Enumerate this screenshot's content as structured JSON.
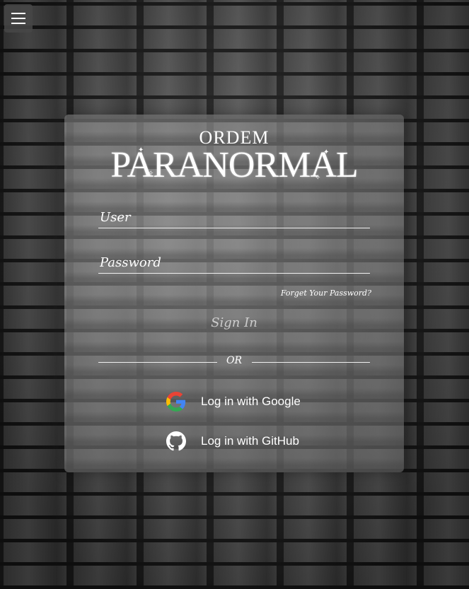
{
  "menu": {
    "icon": "hamburger-menu-icon"
  },
  "logo": {
    "top_text": "ORDEM",
    "main_text": "PARANORMAL"
  },
  "form": {
    "user_placeholder": "User",
    "password_placeholder": "Password",
    "forgot_label": "Forget Your Password?",
    "signin_label": "Sign In",
    "or_label": "OR"
  },
  "social": {
    "google_label": "Log in with Google",
    "google_icon": "google-icon",
    "github_label": "Log in with GitHub",
    "github_icon": "github-icon"
  }
}
